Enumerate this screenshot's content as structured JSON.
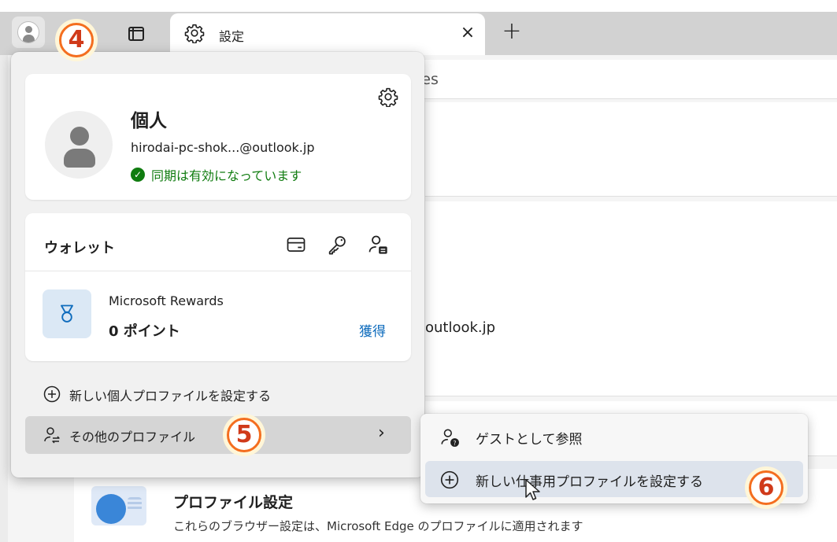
{
  "tabstrip": {
    "tab_title": "設定",
    "close_glyph": "×",
    "new_tab_glyph": "+"
  },
  "background": {
    "search_fragment": "les",
    "email_fragment": "outlook.jp",
    "profile_settings_title": "プロファイル設定",
    "profile_settings_desc": "これらのブラウザー設定は、Microsoft Edge のプロファイルに適用されます"
  },
  "profile_card": {
    "name": "個人",
    "email": "hirodai-pc-shok...@outlook.jp",
    "sync_status": "同期は有効になっています",
    "sync_color": "#107c10"
  },
  "wallet": {
    "title": "ウォレット",
    "icons": [
      "card-icon",
      "key-icon",
      "profile-lock-icon"
    ],
    "rewards_label": "Microsoft Rewards",
    "points": "0 ポイント",
    "earn_label": "獲得",
    "earn_color": "#0f6cbd"
  },
  "menu": {
    "new_personal_profile": "新しい個人プロファイルを設定する",
    "other_profiles": "その他のプロファイル",
    "chevron": "›"
  },
  "submenu": {
    "browse_as_guest": "ゲストとして参照",
    "new_work_profile": "新しい仕事用プロファイルを設定する"
  },
  "badges": {
    "step4": "4",
    "step5": "5",
    "step6": "6",
    "accent": "#f46e1f"
  }
}
